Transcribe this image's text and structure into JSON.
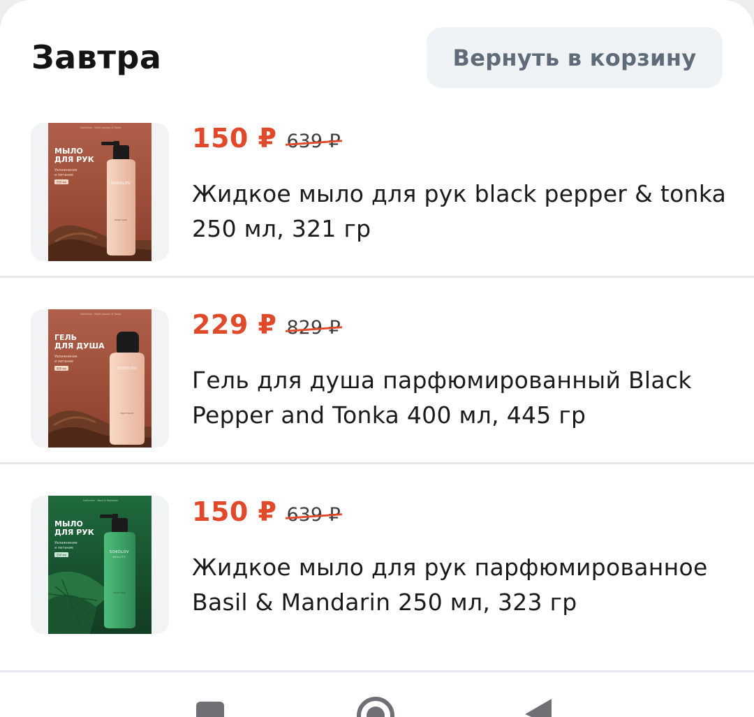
{
  "header": {
    "title": "Завтра",
    "return_button_label": "Вернуть в корзину"
  },
  "products": [
    {
      "price": "150 ₽",
      "old_price": "639 ₽",
      "name": "Жидкое мыло для рук black pepper & tonka 250 мл, 321 гр",
      "image": {
        "panel_title": "МЫЛО ДЛЯ РУК",
        "panel_subtitle": "Увлажнение и питание",
        "panel_badge": "250 мл",
        "bottle_brand": "SOKOLOV",
        "background_color": "#a9573f",
        "bottle_color": "#f0c6ae"
      }
    },
    {
      "price": "229 ₽",
      "old_price": "829 ₽",
      "name": "Гель для душа парфюмированный Black Pepper and Tonka 400 мл, 445 гр",
      "image": {
        "panel_title": "ГЕЛЬ ДЛЯ ДУША",
        "panel_subtitle": "Увлажнение и питание",
        "panel_badge": "400 мл",
        "bottle_brand": "SOKOLOV",
        "background_color": "#a9573f",
        "bottle_color": "#f1c8b0"
      }
    },
    {
      "price": "150 ₽",
      "old_price": "639 ₽",
      "name": "Жидкое мыло для рук парфюмированное Basil & Mandarin 250 мл, 323 гр",
      "image": {
        "panel_title": "МЫЛО ДЛЯ РУК",
        "panel_subtitle": "Увлажнение и питание",
        "panel_badge": "250 мл",
        "bottle_brand": "SOKOLOV",
        "background_color": "#1d5a35",
        "bottle_color": "#3ea86a"
      }
    }
  ],
  "colors": {
    "accent_price": "#e0492a",
    "button_bg": "#f0f3f6",
    "button_text": "#5f6b78"
  },
  "navbar": {
    "icons": [
      "recents-square-icon",
      "home-circle-icon",
      "back-triangle-icon"
    ]
  }
}
